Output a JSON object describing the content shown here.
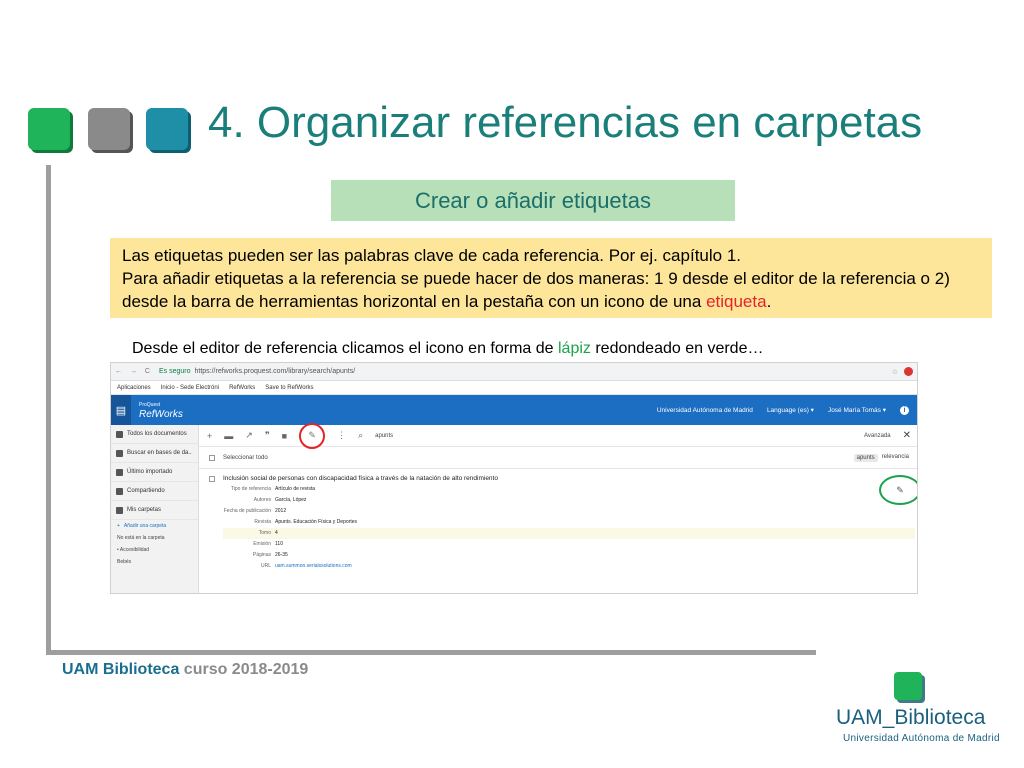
{
  "slide": {
    "title": "4. Organizar referencias en carpetas",
    "subtitle": "Crear o añadir etiquetas",
    "note": {
      "line1": "Las etiquetas pueden ser las palabras clave de cada referencia. Por ej. capítulo 1.",
      "line2_pre": "Para añadir etiquetas a la referencia se puede hacer de dos maneras: 1 9 desde el editor de la referencia o 2) desde la barra de herramientas horizontal en la pestaña con un icono de una ",
      "line2_red": "etiqueta",
      "line2_post": "."
    },
    "caption": {
      "pre": "Desde el editor de referencia clicamos el icono en forma de ",
      "green": "lápiz",
      "post": " redondeado en verde…"
    },
    "footer": {
      "brand": "UAM Biblioteca",
      "course": " curso 2018-2019"
    },
    "logo": {
      "main": "UAM_Biblioteca",
      "sub": "Universidad Autónoma de Madrid"
    }
  },
  "browser": {
    "nav_icons": "← → C",
    "secure_label": "Es seguro",
    "url": "https://refworks.proquest.com/library/search/apunts/",
    "bookmarks": [
      "Aplicaciones",
      "Inicio - Sede Electróni",
      "RefWorks",
      "Save to RefWorks"
    ]
  },
  "app": {
    "brand_small": "ProQuest",
    "brand_big": "RefWorks",
    "university": "Universidad Autónoma de Madrid",
    "language": "Language (es) ▾",
    "user": "José María Tomás ▾",
    "info": "i",
    "sidebar": {
      "items": [
        "Todos los documentos",
        "Buscar en bases de da..",
        "Último importado",
        "Compartiendo",
        "Mis carpetas"
      ],
      "subitems": [
        "Añadir una carpeta",
        "No está en la carpeta",
        "• Accesibilidad",
        "Bebés"
      ]
    },
    "toolbar": {
      "icons": [
        "+",
        "▬",
        "↗",
        "❞",
        "■",
        "✎",
        "⋮",
        "⌕"
      ],
      "search_value": "apunts",
      "advanced": "Avanzada",
      "close": "✕"
    },
    "selection": {
      "select_all": "Seleccionar todo",
      "sort_search": "apunts",
      "sort_label": "relevancia"
    },
    "reference": {
      "title": "Inclusión social de personas con discapacidad física a través de la natación de alto rendimiento",
      "fields": [
        {
          "k": "Tipo de referencia",
          "v": "Artículo de revista"
        },
        {
          "k": "Autores",
          "v": "García, López"
        },
        {
          "k": "Fecha de publicación",
          "v": "2012"
        },
        {
          "k": "Revista",
          "v": "Apunts. Educación Física y Deportes"
        },
        {
          "k": "Tomo",
          "v": "4"
        },
        {
          "k": "Emisión",
          "v": "110"
        },
        {
          "k": "Páginas",
          "v": "26-35"
        },
        {
          "k": "URL",
          "v": "uam.summon.serialssolutions.com"
        }
      ],
      "edit_icon": "✎"
    }
  },
  "colors": {
    "title": "#1a7f7a",
    "subtitle_bg": "#b8e0b8",
    "note_bg": "#fde59a",
    "highlight_red": "#e3242b",
    "highlight_green": "#1aa34a",
    "appbar": "#1b6ec2"
  }
}
